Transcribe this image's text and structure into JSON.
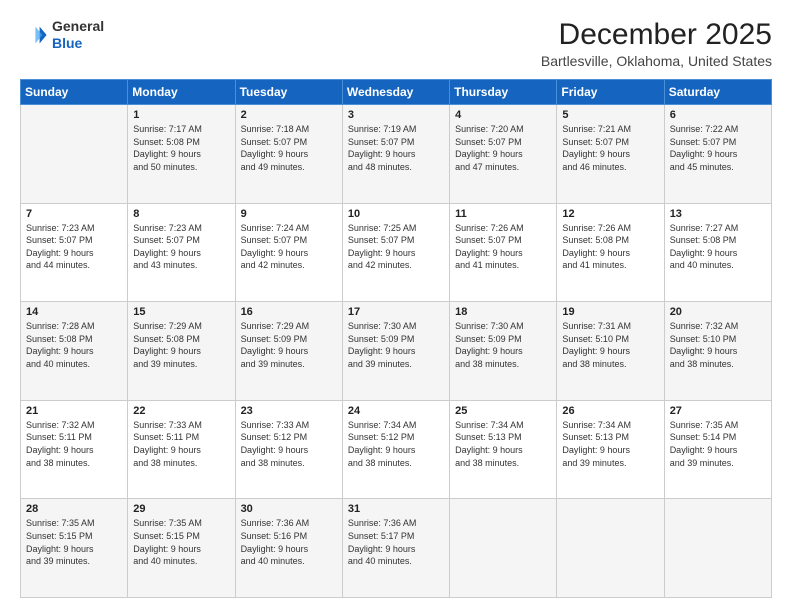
{
  "header": {
    "logo": {
      "line1": "General",
      "line2": "Blue"
    },
    "title": "December 2025",
    "subtitle": "Bartlesville, Oklahoma, United States"
  },
  "calendar": {
    "headers": [
      "Sunday",
      "Monday",
      "Tuesday",
      "Wednesday",
      "Thursday",
      "Friday",
      "Saturday"
    ],
    "weeks": [
      [
        {
          "day": "",
          "info": ""
        },
        {
          "day": "1",
          "info": "Sunrise: 7:17 AM\nSunset: 5:08 PM\nDaylight: 9 hours\nand 50 minutes."
        },
        {
          "day": "2",
          "info": "Sunrise: 7:18 AM\nSunset: 5:07 PM\nDaylight: 9 hours\nand 49 minutes."
        },
        {
          "day": "3",
          "info": "Sunrise: 7:19 AM\nSunset: 5:07 PM\nDaylight: 9 hours\nand 48 minutes."
        },
        {
          "day": "4",
          "info": "Sunrise: 7:20 AM\nSunset: 5:07 PM\nDaylight: 9 hours\nand 47 minutes."
        },
        {
          "day": "5",
          "info": "Sunrise: 7:21 AM\nSunset: 5:07 PM\nDaylight: 9 hours\nand 46 minutes."
        },
        {
          "day": "6",
          "info": "Sunrise: 7:22 AM\nSunset: 5:07 PM\nDaylight: 9 hours\nand 45 minutes."
        }
      ],
      [
        {
          "day": "7",
          "info": "Sunrise: 7:23 AM\nSunset: 5:07 PM\nDaylight: 9 hours\nand 44 minutes."
        },
        {
          "day": "8",
          "info": "Sunrise: 7:23 AM\nSunset: 5:07 PM\nDaylight: 9 hours\nand 43 minutes."
        },
        {
          "day": "9",
          "info": "Sunrise: 7:24 AM\nSunset: 5:07 PM\nDaylight: 9 hours\nand 42 minutes."
        },
        {
          "day": "10",
          "info": "Sunrise: 7:25 AM\nSunset: 5:07 PM\nDaylight: 9 hours\nand 42 minutes."
        },
        {
          "day": "11",
          "info": "Sunrise: 7:26 AM\nSunset: 5:07 PM\nDaylight: 9 hours\nand 41 minutes."
        },
        {
          "day": "12",
          "info": "Sunrise: 7:26 AM\nSunset: 5:08 PM\nDaylight: 9 hours\nand 41 minutes."
        },
        {
          "day": "13",
          "info": "Sunrise: 7:27 AM\nSunset: 5:08 PM\nDaylight: 9 hours\nand 40 minutes."
        }
      ],
      [
        {
          "day": "14",
          "info": "Sunrise: 7:28 AM\nSunset: 5:08 PM\nDaylight: 9 hours\nand 40 minutes."
        },
        {
          "day": "15",
          "info": "Sunrise: 7:29 AM\nSunset: 5:08 PM\nDaylight: 9 hours\nand 39 minutes."
        },
        {
          "day": "16",
          "info": "Sunrise: 7:29 AM\nSunset: 5:09 PM\nDaylight: 9 hours\nand 39 minutes."
        },
        {
          "day": "17",
          "info": "Sunrise: 7:30 AM\nSunset: 5:09 PM\nDaylight: 9 hours\nand 39 minutes."
        },
        {
          "day": "18",
          "info": "Sunrise: 7:30 AM\nSunset: 5:09 PM\nDaylight: 9 hours\nand 38 minutes."
        },
        {
          "day": "19",
          "info": "Sunrise: 7:31 AM\nSunset: 5:10 PM\nDaylight: 9 hours\nand 38 minutes."
        },
        {
          "day": "20",
          "info": "Sunrise: 7:32 AM\nSunset: 5:10 PM\nDaylight: 9 hours\nand 38 minutes."
        }
      ],
      [
        {
          "day": "21",
          "info": "Sunrise: 7:32 AM\nSunset: 5:11 PM\nDaylight: 9 hours\nand 38 minutes."
        },
        {
          "day": "22",
          "info": "Sunrise: 7:33 AM\nSunset: 5:11 PM\nDaylight: 9 hours\nand 38 minutes."
        },
        {
          "day": "23",
          "info": "Sunrise: 7:33 AM\nSunset: 5:12 PM\nDaylight: 9 hours\nand 38 minutes."
        },
        {
          "day": "24",
          "info": "Sunrise: 7:34 AM\nSunset: 5:12 PM\nDaylight: 9 hours\nand 38 minutes."
        },
        {
          "day": "25",
          "info": "Sunrise: 7:34 AM\nSunset: 5:13 PM\nDaylight: 9 hours\nand 38 minutes."
        },
        {
          "day": "26",
          "info": "Sunrise: 7:34 AM\nSunset: 5:13 PM\nDaylight: 9 hours\nand 39 minutes."
        },
        {
          "day": "27",
          "info": "Sunrise: 7:35 AM\nSunset: 5:14 PM\nDaylight: 9 hours\nand 39 minutes."
        }
      ],
      [
        {
          "day": "28",
          "info": "Sunrise: 7:35 AM\nSunset: 5:15 PM\nDaylight: 9 hours\nand 39 minutes."
        },
        {
          "day": "29",
          "info": "Sunrise: 7:35 AM\nSunset: 5:15 PM\nDaylight: 9 hours\nand 40 minutes."
        },
        {
          "day": "30",
          "info": "Sunrise: 7:36 AM\nSunset: 5:16 PM\nDaylight: 9 hours\nand 40 minutes."
        },
        {
          "day": "31",
          "info": "Sunrise: 7:36 AM\nSunset: 5:17 PM\nDaylight: 9 hours\nand 40 minutes."
        },
        {
          "day": "",
          "info": ""
        },
        {
          "day": "",
          "info": ""
        },
        {
          "day": "",
          "info": ""
        }
      ]
    ]
  }
}
